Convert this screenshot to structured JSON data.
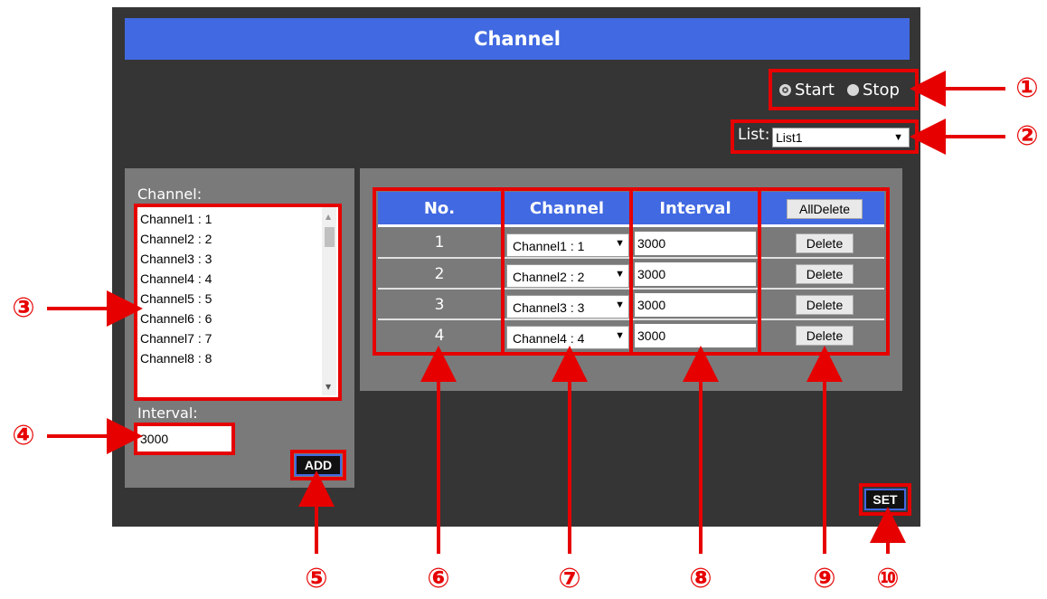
{
  "title": "Channel",
  "radio": {
    "start_label": "Start",
    "stop_label": "Stop",
    "selected": "Start"
  },
  "list_select": {
    "label": "List:",
    "value": "List1"
  },
  "left": {
    "channel_label": "Channel:",
    "channels": [
      "Channel1 : 1",
      "Channel2 : 2",
      "Channel3 : 3",
      "Channel4 : 4",
      "Channel5 : 5",
      "Channel6 : 6",
      "Channel7 : 7",
      "Channel8 : 8"
    ],
    "interval_label": "Interval:",
    "interval_value": "3000",
    "add_label": "ADD"
  },
  "table": {
    "headers": {
      "no": "No.",
      "channel": "Channel",
      "interval": "Interval",
      "all_delete": "AllDelete"
    },
    "rows": [
      {
        "no": "1",
        "channel": "Channel1 : 1",
        "interval": "3000",
        "delete": "Delete"
      },
      {
        "no": "2",
        "channel": "Channel2 : 2",
        "interval": "3000",
        "delete": "Delete"
      },
      {
        "no": "3",
        "channel": "Channel3 : 3",
        "interval": "3000",
        "delete": "Delete"
      },
      {
        "no": "4",
        "channel": "Channel4 : 4",
        "interval": "3000",
        "delete": "Delete"
      }
    ]
  },
  "set_label": "SET",
  "callout_numbers": [
    "①",
    "②",
    "③",
    "④",
    "⑤",
    "⑥",
    "⑦",
    "⑧",
    "⑨",
    "⑩"
  ],
  "colors": {
    "accent": "#4169e1",
    "callout": "#e60000",
    "panel": "#353535",
    "subpanel": "#7a7a7a"
  }
}
